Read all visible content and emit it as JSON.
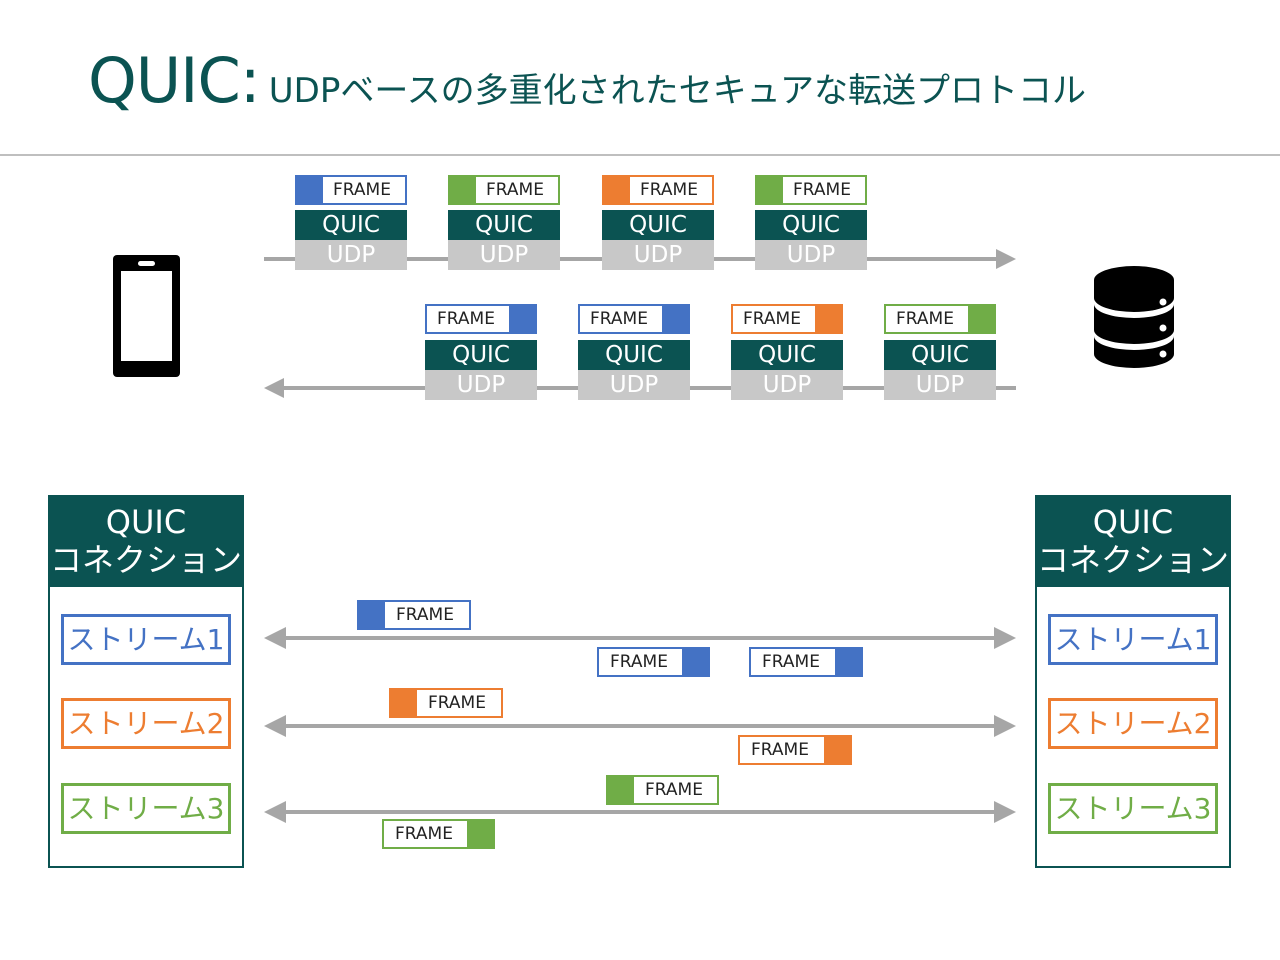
{
  "title": {
    "main": "QUIC:",
    "sub": "UDPベースの多重化されたセキュアな転送プロトコル"
  },
  "labels": {
    "frame": "FRAME",
    "quic": "QUIC",
    "udp": "UDP"
  },
  "connection": {
    "header_line1": "QUIC",
    "header_line2": "コネクション",
    "streams": [
      "ストリーム1",
      "ストリーム2",
      "ストリーム3"
    ]
  },
  "icons": {
    "client": "smartphone-icon",
    "server": "database-server-icon"
  },
  "colors": {
    "teal": "#0b5352",
    "blue": "#4472c4",
    "orange": "#ed7d31",
    "green": "#70ad47",
    "gray": "#a6a6a6",
    "udp_gray": "#c8c8c8"
  }
}
